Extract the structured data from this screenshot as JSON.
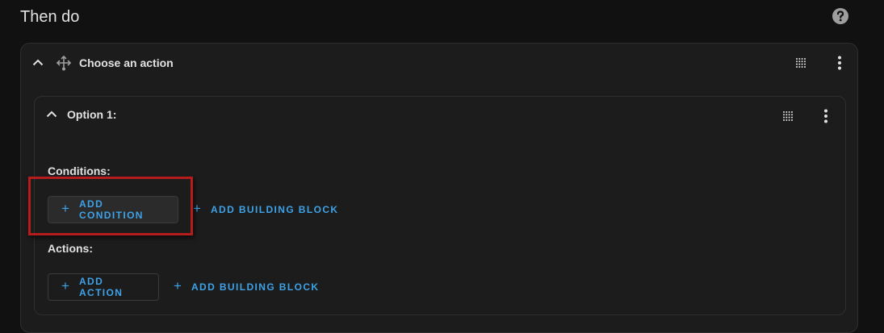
{
  "section": {
    "title": "Then do"
  },
  "icons": {
    "help": "help-circle-icon",
    "collapse": "chevron-up-icon",
    "action_type": "arrow-decision-icon",
    "drag": "drag-handle-icon",
    "menu": "dots-vertical-icon",
    "add": "plus-icon"
  },
  "action_card": {
    "title": "Choose an action",
    "option": {
      "title": "Option 1:",
      "conditions_label": "Conditions:",
      "add_condition_label": "ADD CONDITION",
      "add_building_block_label": "ADD BUILDING BLOCK",
      "actions_label": "Actions:",
      "add_action_label": "ADD ACTION",
      "add_building_block_label_2": "ADD BUILDING BLOCK"
    }
  },
  "colors": {
    "background": "#111111",
    "card": "#1c1c1c",
    "accent": "#3ea2e8",
    "highlight": "#b51d1d"
  }
}
